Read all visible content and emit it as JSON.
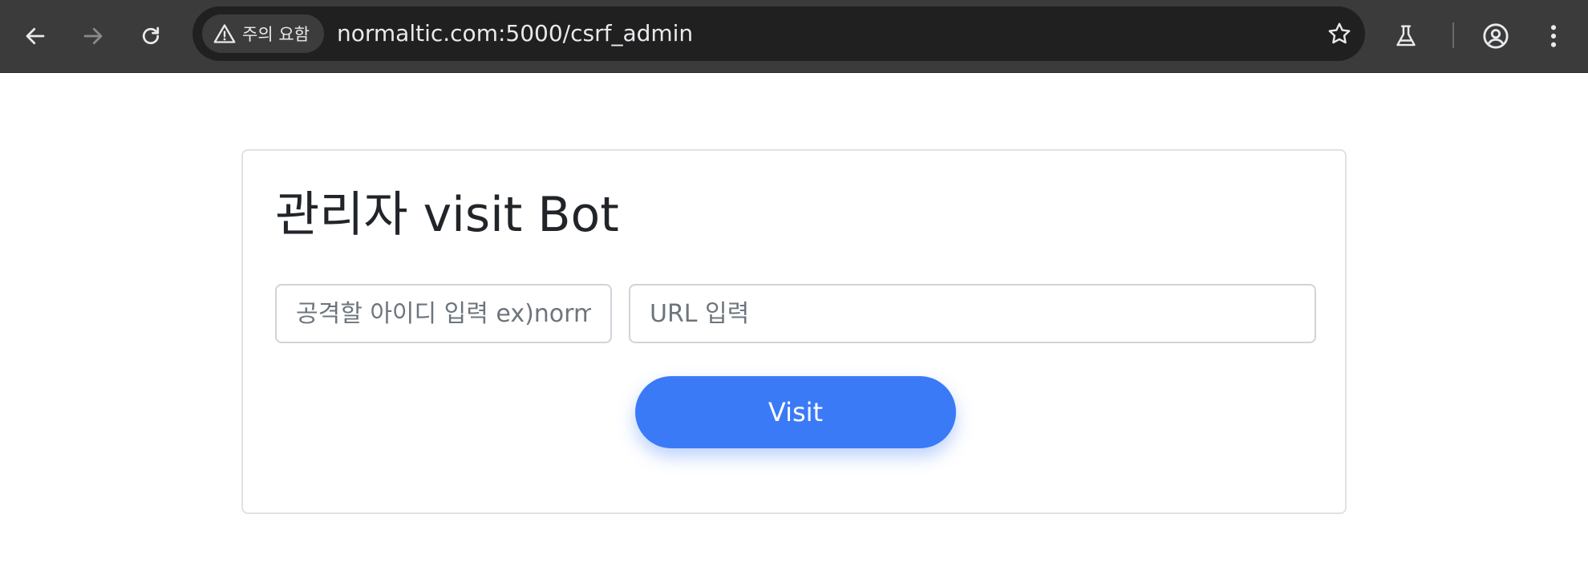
{
  "browser": {
    "security_chip_label": "주의 요함",
    "url": "normaltic.com:5000/csrf_admin",
    "icons": {
      "back": "back-arrow-icon",
      "forward": "forward-arrow-icon",
      "reload": "reload-icon",
      "warning": "warning-triangle-icon",
      "star": "star-icon",
      "labs": "flask-icon",
      "profile": "profile-icon",
      "menu": "kebab-menu-icon"
    }
  },
  "page": {
    "title": "관리자 visit Bot",
    "id_input": {
      "placeholder": "공격할 아이디 입력 ex)normaltic",
      "value": ""
    },
    "url_input": {
      "placeholder": "URL 입력",
      "value": ""
    },
    "visit_button_label": "Visit"
  },
  "colors": {
    "accent": "#3b7af7",
    "chrome_bg": "#3b3b3b",
    "omnibox_bg": "#202020",
    "card_border": "#dee2e6"
  }
}
